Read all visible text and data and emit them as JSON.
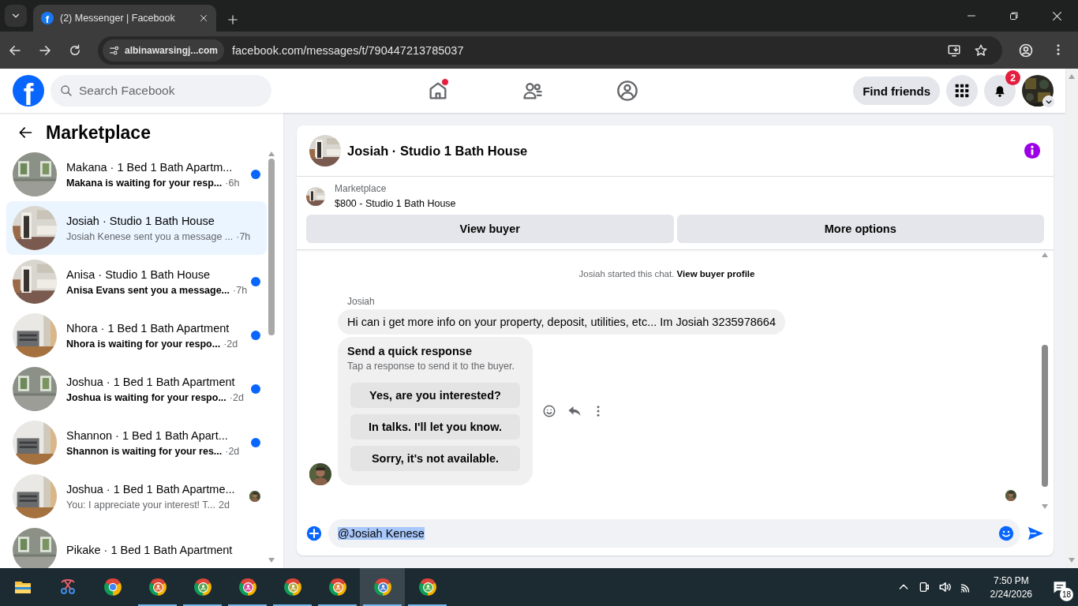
{
  "browser": {
    "favicon": "f",
    "tab_title": "(2) Messenger | Facebook",
    "site_chip": "albinawarsingj...com",
    "url": "facebook.com/messages/t/790447213785037"
  },
  "topbar": {
    "logo": "f",
    "search": {
      "placeholder": "Search Facebook"
    },
    "nav": [
      {
        "kind": "home",
        "badge": true
      },
      {
        "kind": "friends",
        "badge": false
      },
      {
        "kind": "groups",
        "badge": false
      }
    ],
    "find_friends": "Find friends",
    "notification_count": "2"
  },
  "sidebar": {
    "title": "Marketplace",
    "conversations": [
      {
        "title": "Makana · 1 Bed 1 Bath Apartm...",
        "preview": "Makana is waiting for your resp...",
        "time": "·6h",
        "unread": true,
        "seen": false,
        "selected": false
      },
      {
        "title": "Josiah · Studio 1 Bath House",
        "preview": "Josiah Kenese sent you a message ...",
        "time": "·7h",
        "unread": false,
        "seen": false,
        "selected": true
      },
      {
        "title": "Anisa · Studio 1 Bath House",
        "preview": "Anisa Evans sent you a message...",
        "time": "·7h",
        "unread": true,
        "seen": false,
        "selected": false
      },
      {
        "title": "Nhora · 1 Bed 1 Bath Apartment",
        "preview": "Nhora is waiting for your respo...",
        "time": "·2d",
        "unread": true,
        "seen": false,
        "selected": false
      },
      {
        "title": "Joshua · 1 Bed 1 Bath Apartment",
        "preview": "Joshua is waiting for your respo...",
        "time": "·2d",
        "unread": true,
        "seen": false,
        "selected": false
      },
      {
        "title": "Shannon · 1 Bed 1 Bath Apart...",
        "preview": "Shannon is waiting for your res...",
        "time": "·2d",
        "unread": true,
        "seen": false,
        "selected": false
      },
      {
        "title": "Joshua · 1 Bed 1 Bath Apartme...",
        "preview": "You: I appreciate your interest! T...",
        "time": "2d",
        "unread": false,
        "seen": true,
        "selected": false
      },
      {
        "title": "Pikake · 1 Bed 1 Bath Apartment",
        "selected": false
      }
    ]
  },
  "chat": {
    "title": "Josiah · Studio 1 Bath House",
    "listing": {
      "label": "Marketplace",
      "title": "$800 - Studio 1 Bath House"
    },
    "actions": [
      "View buyer",
      "More options"
    ],
    "system_message": {
      "text": "Josiah started this chat.",
      "link": "View buyer profile"
    },
    "sender": "Josiah",
    "message": "Hi can i get more info on your property, deposit, utilities, etc... Im Josiah 3235978664",
    "quick_response": {
      "title": "Send a quick response",
      "subtitle": "Tap a response to send it to the buyer.",
      "options": [
        "Yes, are you interested?",
        "In talks. I'll let you know.",
        "Sorry, it's not available."
      ]
    },
    "composer": {
      "value": "@Josiah Kenese",
      "highlighted": true
    }
  },
  "taskbar": {
    "apps": [
      {
        "kind": "folder",
        "running": false,
        "selected": false
      },
      {
        "kind": "snip",
        "running": false,
        "selected": false
      },
      {
        "kind": "chrome",
        "running": false,
        "selected": false
      },
      {
        "kind": "chrome-profile",
        "color": "#e0683a",
        "running": true,
        "selected": false
      },
      {
        "kind": "chrome-profile",
        "color": "#5aa24a",
        "running": true,
        "selected": false
      },
      {
        "kind": "chrome-profile",
        "color": "#d6489a",
        "running": true,
        "selected": false
      },
      {
        "kind": "chrome-profile",
        "color": "#b3a83e",
        "running": true,
        "selected": false
      },
      {
        "kind": "chrome-profile",
        "color": "#e5863a",
        "running": true,
        "selected": false
      },
      {
        "kind": "chrome-profile",
        "color": "#4a7fd4",
        "running": true,
        "selected": true
      },
      {
        "kind": "chrome-profile",
        "color": "#4caf50",
        "running": true,
        "selected": false
      }
    ],
    "time": "7:50 PM",
    "date": "2/24/2026",
    "notification_count": "18"
  }
}
